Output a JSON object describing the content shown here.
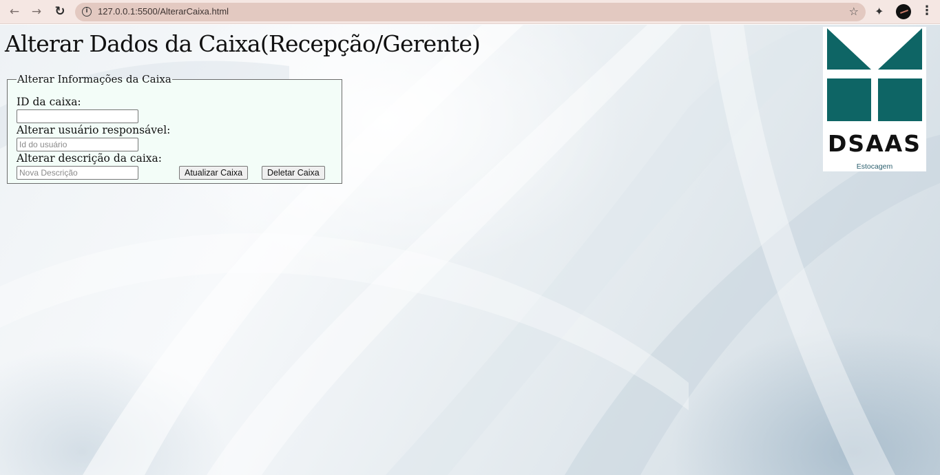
{
  "browser": {
    "url": "127.0.0.1:5500/AlterarCaixa.html",
    "icons": [
      "back-arrow-icon",
      "forward-arrow-icon",
      "reload-icon",
      "info-icon",
      "star-icon",
      "extensions-puzzle-icon",
      "profile-avatar",
      "more-menu-icon"
    ]
  },
  "page": {
    "title": "Alterar Dados da Caixa(Recepção/Gerente)"
  },
  "form": {
    "legend": "Alterar Informações da Caixa",
    "id_label": "ID da caixa:",
    "id_value": "",
    "user_label": "Alterar usuário responsável:",
    "user_placeholder": "Id do usuário",
    "desc_label": "Alterar descrição da caixa:",
    "desc_placeholder": "Nova Descrição",
    "update_button": "Atualizar Caixa",
    "delete_button": "Deletar Caixa"
  },
  "logo": {
    "word": "DSAAS",
    "subtitle": "Estocagem",
    "color": "#0e6565"
  }
}
